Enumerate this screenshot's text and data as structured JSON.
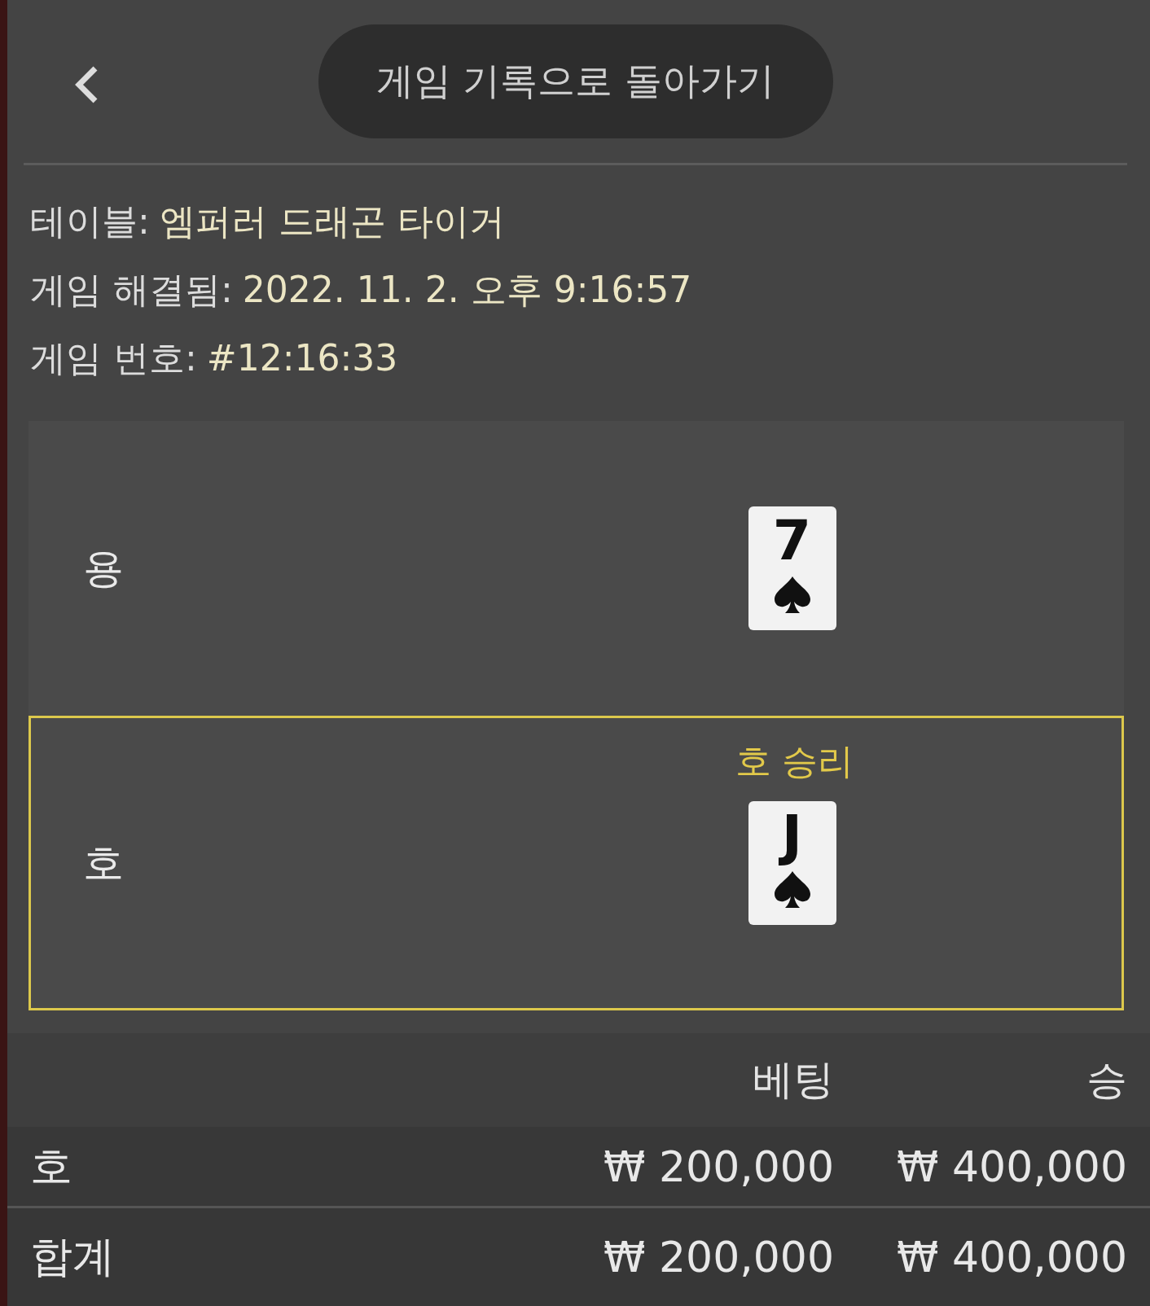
{
  "header": {
    "title": "게임 기록으로 돌아가기"
  },
  "info": [
    {
      "label": "테이블:",
      "value": "엠퍼러 드래곤 타이거"
    },
    {
      "label": "게임 해결됨:",
      "value": "2022. 11. 2. 오후 9:16:57"
    },
    {
      "label": "게임 번호:",
      "value": "#12:16:33"
    }
  ],
  "hands": [
    {
      "name": "용",
      "winner": false,
      "card": {
        "rank": "7",
        "kind": "spade"
      }
    },
    {
      "name": "호",
      "winner": true,
      "result": "호 승리",
      "card": {
        "rank": "J",
        "kind": "spade"
      }
    }
  ],
  "bets": {
    "columns": [
      "베팅",
      "승"
    ],
    "rows": [
      {
        "kind": "row",
        "label": "호",
        "bet": "₩ 200,000",
        "win": "₩ 400,000"
      },
      {
        "kind": "total",
        "label": "합계",
        "bet": "₩ 200,000",
        "win": "₩ 400,000"
      }
    ]
  }
}
